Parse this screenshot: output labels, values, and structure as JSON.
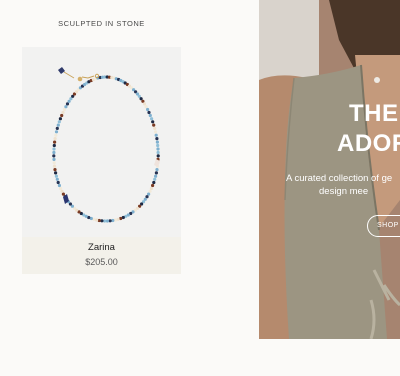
{
  "collection": {
    "label": "SCULPTED IN STONE"
  },
  "product": {
    "name": "Zarina",
    "price": "$205.00"
  },
  "hero": {
    "title_line1": "THE",
    "title_line2": "ADOR",
    "subtitle_line1": "A curated collection of ge",
    "subtitle_line2": "design mee",
    "cta_label": "SHOP T"
  }
}
